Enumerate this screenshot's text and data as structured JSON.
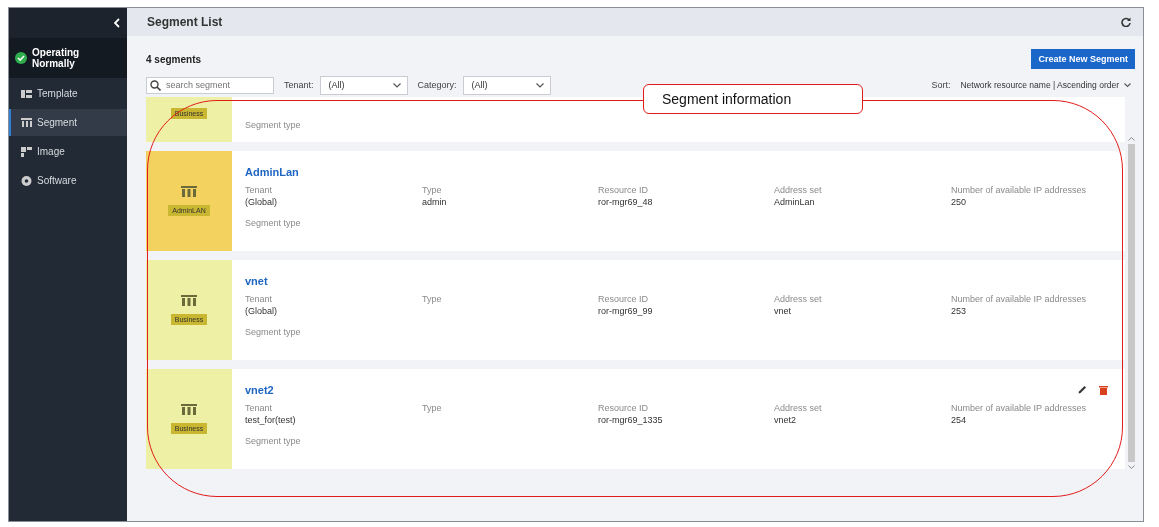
{
  "sidebar": {
    "status": "Operating Normally",
    "items": [
      {
        "label": "Template",
        "selected": false
      },
      {
        "label": "Segment",
        "selected": true
      },
      {
        "label": "Image",
        "selected": false
      },
      {
        "label": "Software",
        "selected": false
      }
    ]
  },
  "header": {
    "title": "Segment List"
  },
  "count": "4 segments",
  "create_button": "Create New Segment",
  "filters": {
    "search": {
      "placeholder": "search segment"
    },
    "tenant": {
      "label": "Tenant:",
      "value": "(All)"
    },
    "category": {
      "label": "Category:",
      "value": "(All)"
    },
    "sort": {
      "label": "Sort:",
      "value": "Network resource name | Ascending order"
    }
  },
  "segments": [
    {
      "kind": "partial",
      "category": "Business",
      "color": "#eef0a6",
      "segment_type_label": "Segment type"
    },
    {
      "kind": "full",
      "name": "AdminLan",
      "category": "AdminLAN",
      "color": "#f3d260",
      "fields": [
        {
          "label": "Tenant",
          "value": "(Global)"
        },
        {
          "label": "Type",
          "value": "admin"
        },
        {
          "label": "Resource ID",
          "value": "ror-mgr69_48"
        },
        {
          "label": "Address set",
          "value": "AdminLan"
        },
        {
          "label": "Number of available IP addresses",
          "value": "250"
        }
      ],
      "segment_type_label": "Segment type",
      "actions": false
    },
    {
      "kind": "full",
      "name": "vnet",
      "category": "Business",
      "color": "#eef0a6",
      "fields": [
        {
          "label": "Tenant",
          "value": "(Global)"
        },
        {
          "label": "Type"
        },
        {
          "label": "Resource ID",
          "value": "ror-mgr69_99"
        },
        {
          "label": "Address set",
          "value": "vnet"
        },
        {
          "label": "Number of available IP addresses",
          "value": "253"
        }
      ],
      "segment_type_label": "Segment type",
      "actions": false
    },
    {
      "kind": "full",
      "name": "vnet2",
      "category": "Business",
      "color": "#eef0a6",
      "fields": [
        {
          "label": "Tenant",
          "value": "test_for(test)"
        },
        {
          "label": "Type"
        },
        {
          "label": "Resource ID",
          "value": "ror-mgr69_1335"
        },
        {
          "label": "Address set",
          "value": "vnet2"
        },
        {
          "label": "Number of available IP addresses",
          "value": "254"
        }
      ],
      "segment_type_label": "Segment type",
      "actions": true
    }
  ],
  "annotation": {
    "label": "Segment information"
  }
}
